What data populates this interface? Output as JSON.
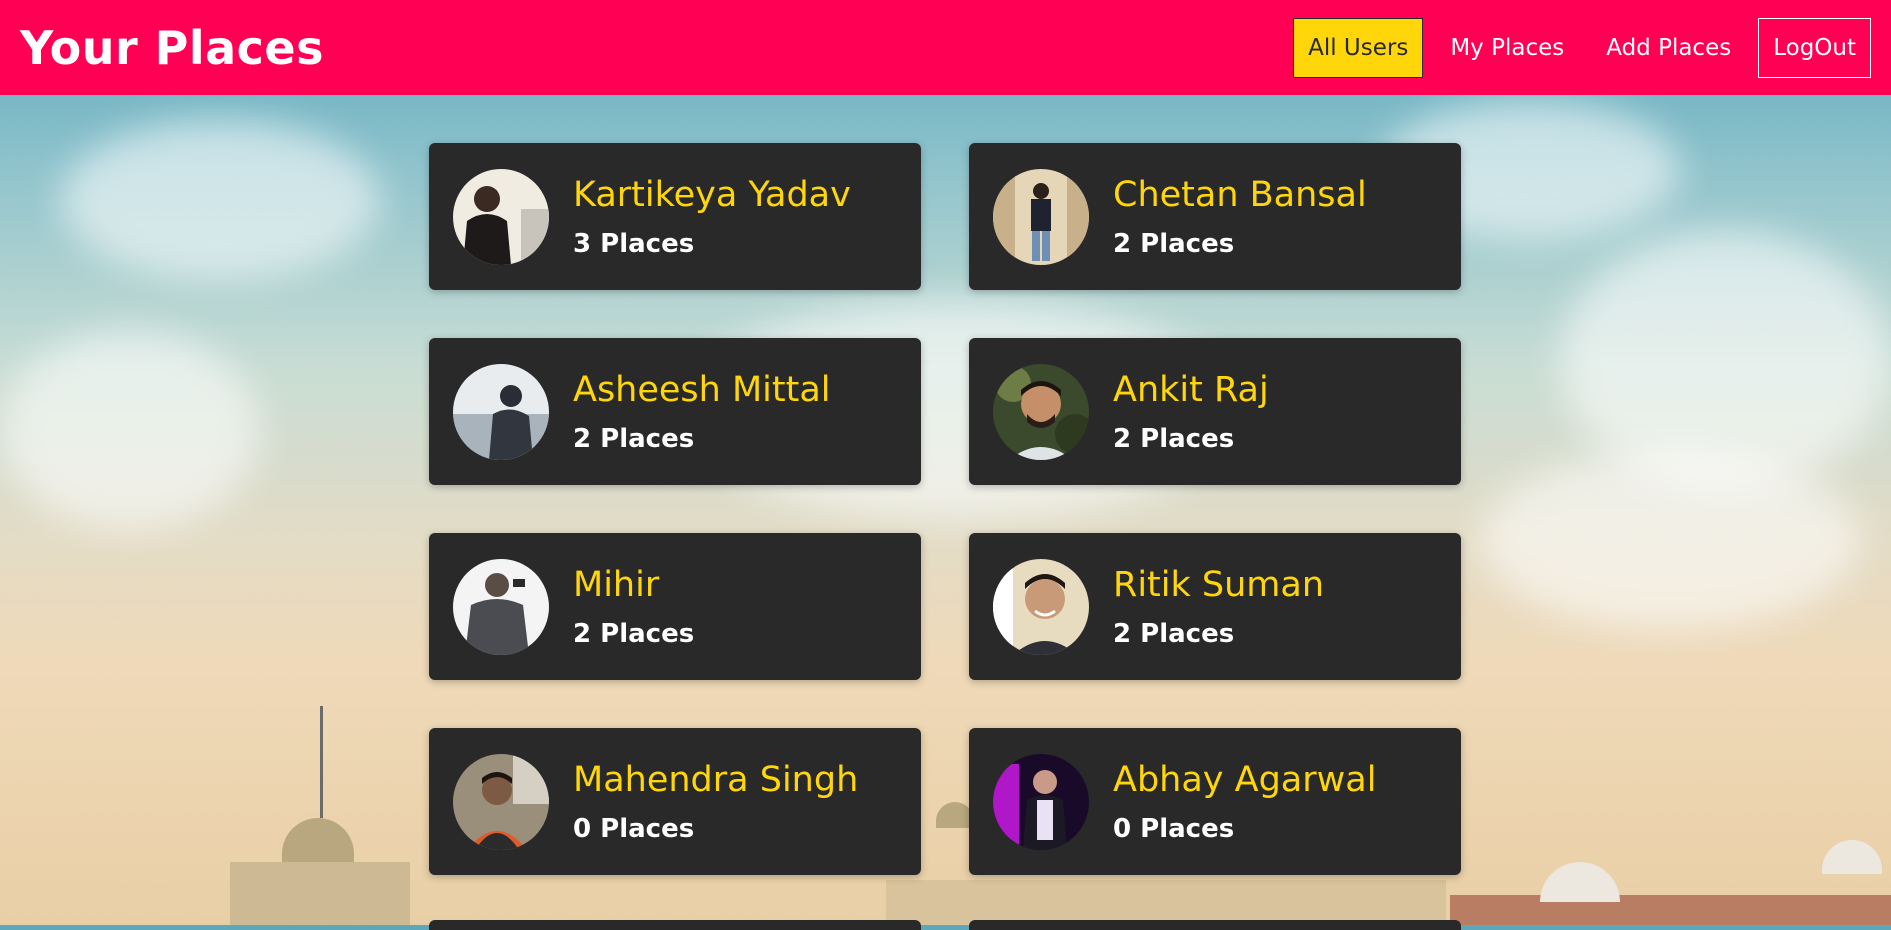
{
  "header": {
    "title": "Your Places",
    "nav": [
      {
        "label": "All Users",
        "active": true
      },
      {
        "label": "My Places",
        "active": false
      },
      {
        "label": "Add Places",
        "active": false
      },
      {
        "label": "LogOut",
        "active": false
      }
    ]
  },
  "users": [
    {
      "name": "Kartikeya Yadav",
      "places": "3 Places"
    },
    {
      "name": "Chetan Bansal",
      "places": "2 Places"
    },
    {
      "name": "Asheesh Mittal",
      "places": "2 Places"
    },
    {
      "name": "Ankit Raj",
      "places": "2 Places"
    },
    {
      "name": "Mihir",
      "places": "2 Places"
    },
    {
      "name": "Ritik Suman",
      "places": "2 Places"
    },
    {
      "name": "Mahendra Singh",
      "places": "0 Places"
    },
    {
      "name": "Abhay Agarwal",
      "places": "0 Places"
    }
  ],
  "colors": {
    "header": "#ff0055",
    "accent": "#ffd60a",
    "card": "#292929"
  }
}
